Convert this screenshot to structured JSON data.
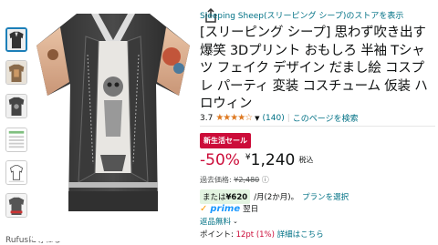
{
  "store_link": "Sleeping Sheep(スリーピング シープ)のストアを表示",
  "title": "[スリーピング シープ] 思わず吹き出す 爆笑 3Dプリント おもしろ 半袖 Tシャツ フェイク デザイン だまし絵 コスプレ パーティ 変装 コスチューム 仮装 ハロウィン",
  "rating": {
    "value": "3.7",
    "stars": "★★★★☆",
    "count": "(140)",
    "sep": "|",
    "search_link": "このページを検索"
  },
  "badge": "新生活セール",
  "price": {
    "discount": "-50%",
    "yen": "¥",
    "amount": "1,240",
    "tax": "税込"
  },
  "past_price": {
    "label": "過去価格:",
    "value": "¥2,480",
    "info": "ⓘ"
  },
  "installment": {
    "prefix": "または",
    "amount": "¥620",
    "suffix": "/月(2か月)。",
    "link": "プランを選択"
  },
  "delivery": {
    "prime": "prime",
    "day": "翌日"
  },
  "returns": "返品無料",
  "points": {
    "label": "ポイント:",
    "value": "12pt (1%)",
    "details": "詳細はこちら"
  },
  "bottom_note": "Rufusに尋ねる",
  "colors": {
    "accent": "#007185",
    "price_red": "#cc0c39",
    "prime_blue": "#1a98ff",
    "install_green": "#e3f4e1"
  }
}
